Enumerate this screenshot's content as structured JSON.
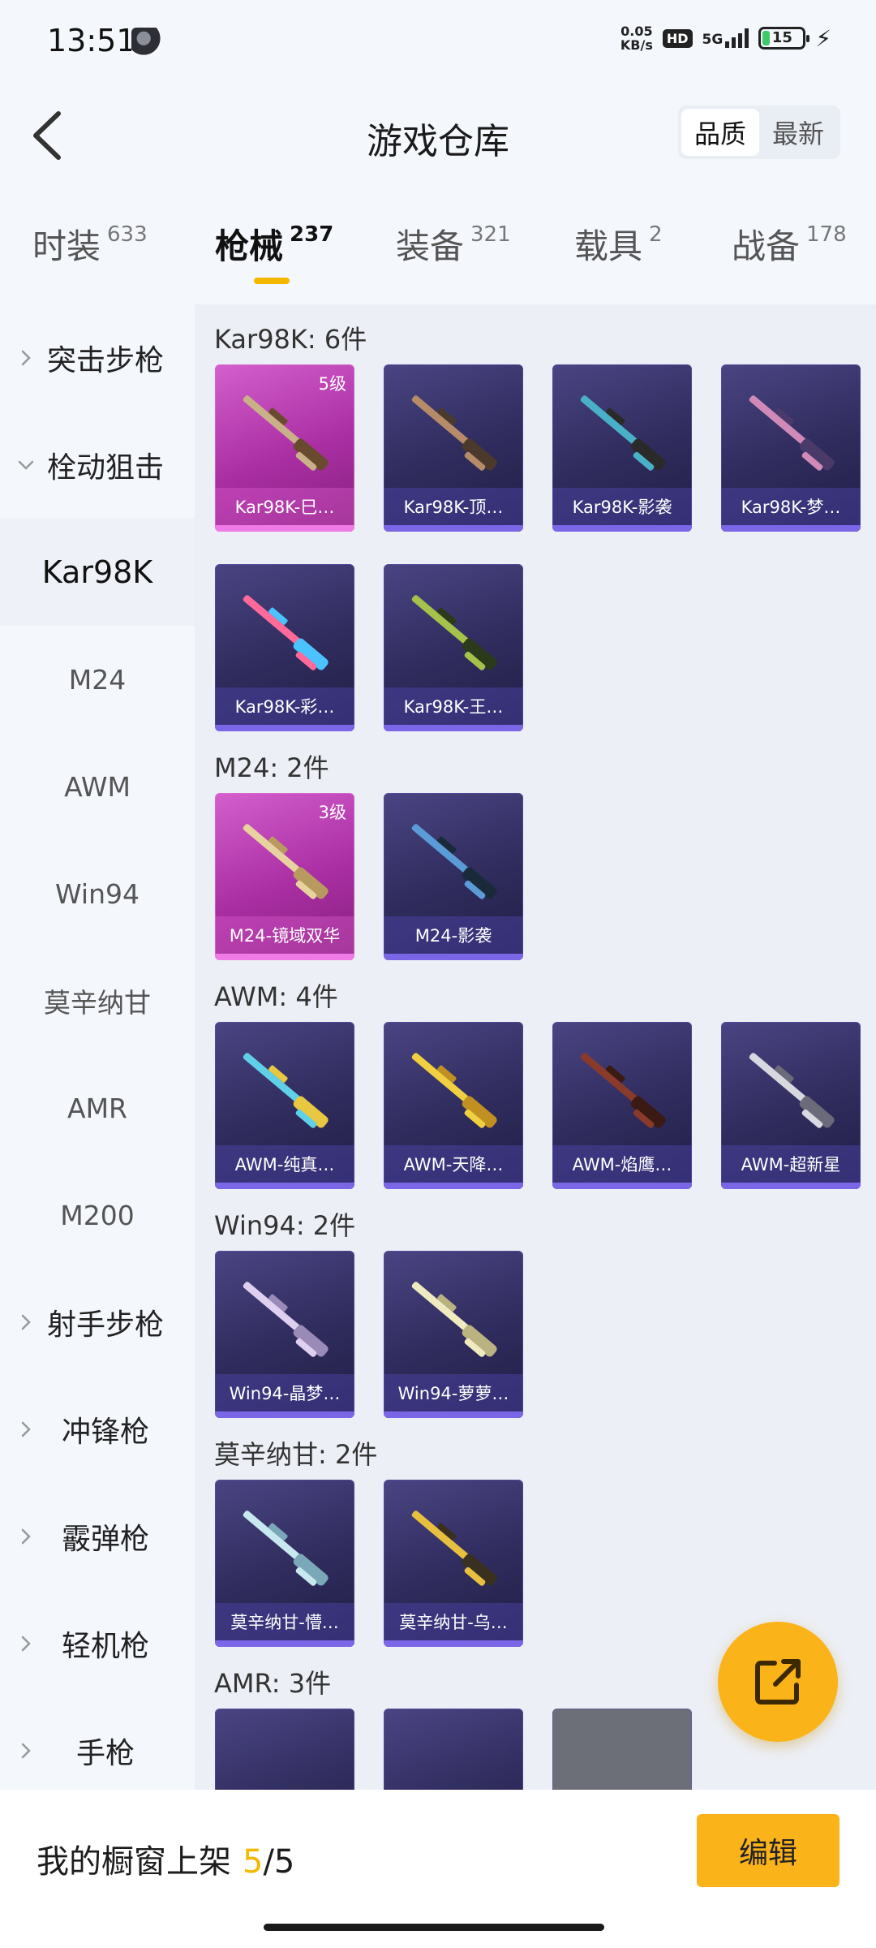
{
  "status": {
    "time": "13:51",
    "net_speed_value": "0.05",
    "net_speed_unit": "KB/s",
    "hd": "HD",
    "signal": "5G",
    "battery": "15"
  },
  "header": {
    "title": "游戏仓库",
    "sort": [
      "品质",
      "最新"
    ],
    "sort_active": 0
  },
  "tabs": [
    {
      "label": "时装",
      "count": "633"
    },
    {
      "label": "枪械",
      "count": "237",
      "active": true
    },
    {
      "label": "装备",
      "count": "321"
    },
    {
      "label": "载具",
      "count": "2"
    },
    {
      "label": "战备",
      "count": "178"
    }
  ],
  "sidebar": {
    "items": [
      {
        "label": "突击步枪"
      },
      {
        "label": "栓动狙击"
      },
      {
        "label": "Kar98K"
      },
      {
        "label": "M24"
      },
      {
        "label": "AWM"
      },
      {
        "label": "Win94"
      },
      {
        "label": "莫辛纳甘"
      },
      {
        "label": "AMR"
      },
      {
        "label": "M200"
      },
      {
        "label": "射手步枪"
      },
      {
        "label": "冲锋枪"
      },
      {
        "label": "霰弹枪"
      },
      {
        "label": "轻机枪"
      },
      {
        "label": "手枪"
      }
    ]
  },
  "groups": [
    {
      "title": "Kar98K: 6件",
      "items": [
        {
          "name": "Kar98K-巳…",
          "level": "5级",
          "rarity": "legend"
        },
        {
          "name": "Kar98K-顶…"
        },
        {
          "name": "Kar98K-影袭"
        },
        {
          "name": "Kar98K-梦…"
        },
        {
          "name": "Kar98K-彩…"
        },
        {
          "name": "Kar98K-王…"
        }
      ]
    },
    {
      "title": "M24: 2件",
      "items": [
        {
          "name": "M24-镜域双华",
          "level": "3级",
          "rarity": "legend"
        },
        {
          "name": "M24-影袭"
        }
      ]
    },
    {
      "title": "AWM: 4件",
      "items": [
        {
          "name": "AWM-纯真…"
        },
        {
          "name": "AWM-天降…"
        },
        {
          "name": "AWM-焰鹰…"
        },
        {
          "name": "AWM-超新星"
        }
      ]
    },
    {
      "title": "Win94: 2件",
      "items": [
        {
          "name": "Win94-晶梦…"
        },
        {
          "name": "Win94-萝萝…"
        }
      ]
    },
    {
      "title": "莫辛纳甘: 2件",
      "items": [
        {
          "name": "莫辛纳甘-懵…"
        },
        {
          "name": "莫辛纳甘-乌…"
        }
      ]
    },
    {
      "title": "AMR: 3件",
      "items": []
    }
  ],
  "bottom": {
    "label": "我的橱窗上架",
    "current": "5",
    "total": "/5",
    "edit": "编辑"
  },
  "colors": {
    "accent": "#fbb31a",
    "legend": "#c13cba",
    "epic": "#3a3570"
  }
}
